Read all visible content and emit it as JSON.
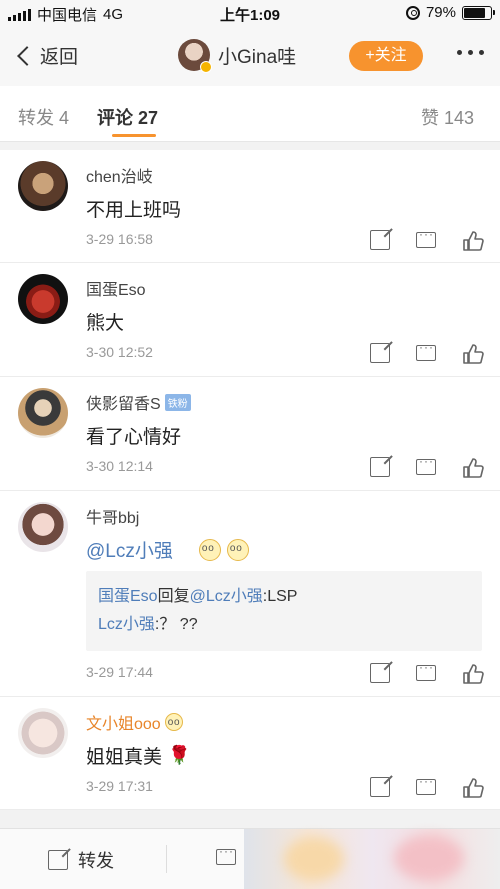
{
  "status_bar": {
    "carrier": "中国电信",
    "network": "4G",
    "time": "上午1:09",
    "battery": "79%",
    "battery_level": 0.79
  },
  "nav": {
    "back_label": "返回",
    "user_name": "小Gina哇",
    "follow_label": "+关注"
  },
  "tabs": {
    "repost": "转发 4",
    "comments": "评论 27",
    "likes": "赞 143"
  },
  "comments": [
    {
      "name": "chen治岐",
      "text": "不用上班吗",
      "time": "3-29 16:58"
    },
    {
      "name": "国蛋Eso",
      "text": "熊大",
      "time": "3-30 12:52"
    },
    {
      "name": "侠影留香S",
      "badge": "铁粉",
      "text": "看了心情好",
      "time": "3-30 12:14"
    },
    {
      "name": "牛哥bbj",
      "text": "@Lcz小强",
      "time": "3-29 17:44",
      "replies": [
        {
          "user": "国蛋Eso",
          "verb": "回复",
          "target": "@Lcz小强",
          "text": ":LSP"
        },
        {
          "user": "Lcz小强",
          "text": ":？ ??"
        }
      ]
    },
    {
      "name": "文小姐ooo",
      "text": "姐姐真美",
      "time": "3-29 17:31"
    }
  ],
  "bottom_bar": {
    "repost_label": "转发"
  }
}
